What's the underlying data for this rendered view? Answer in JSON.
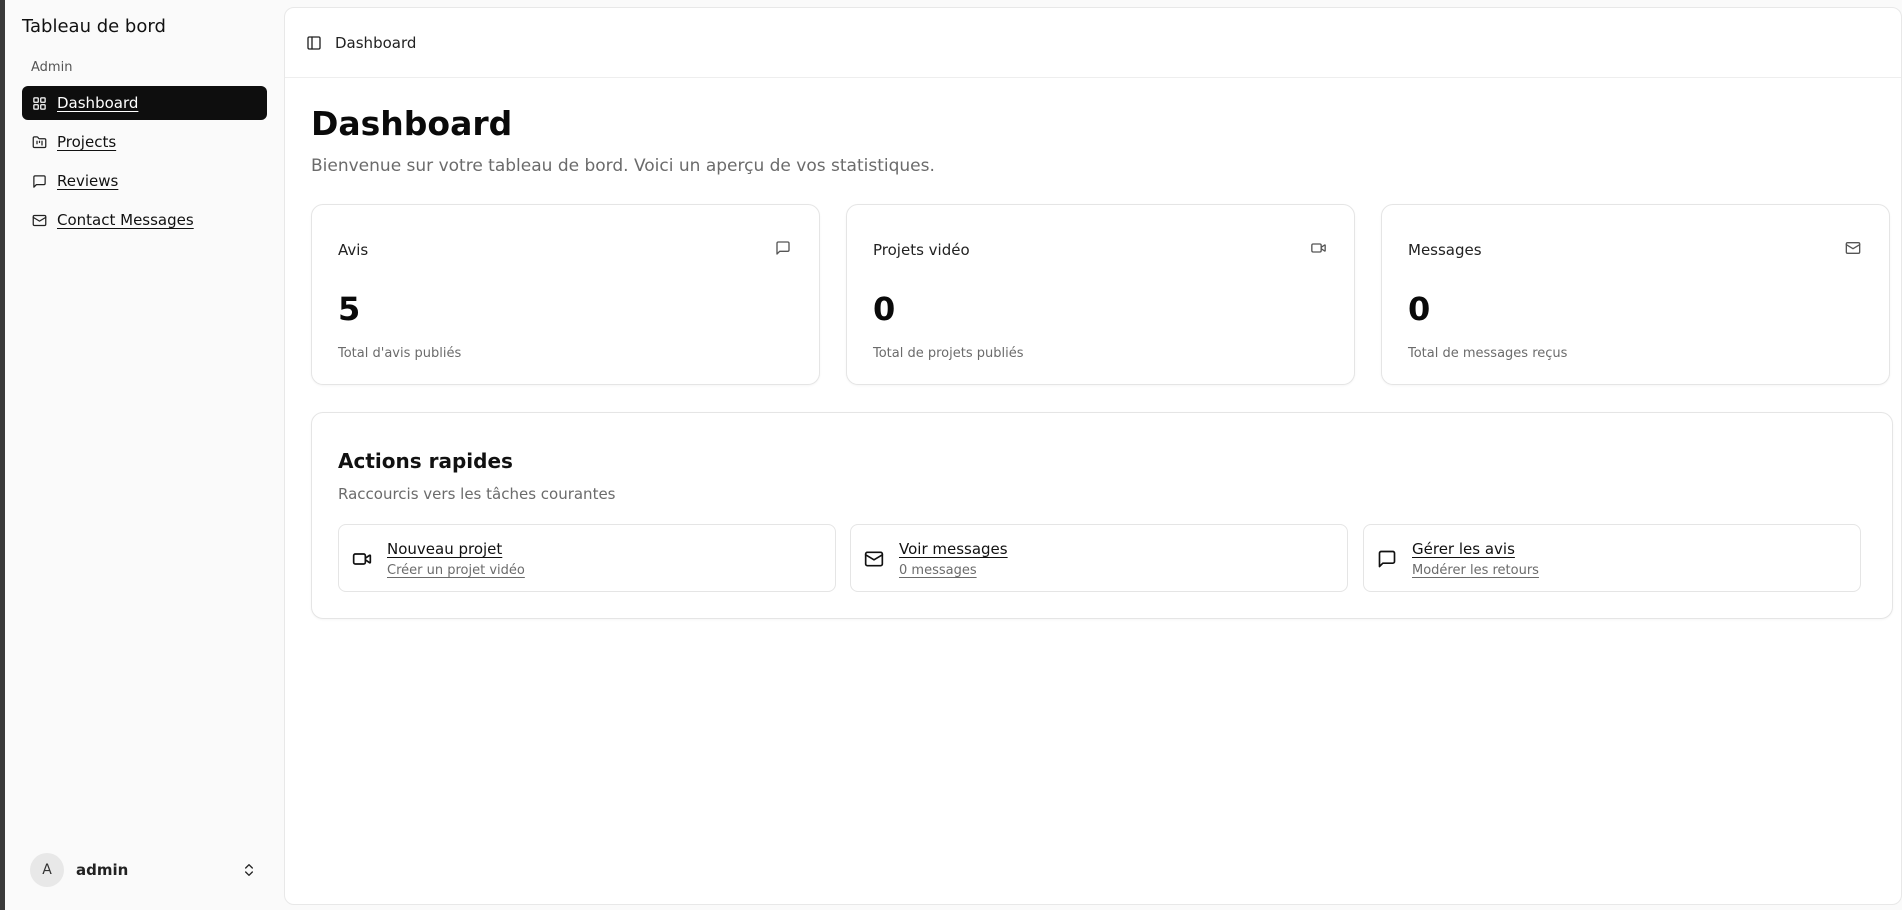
{
  "sidebar": {
    "brand": "Tableau de bord",
    "group_label": "Admin",
    "items": [
      {
        "label": "Dashboard",
        "icon": "grid-icon",
        "active": true
      },
      {
        "label": "Projects",
        "icon": "folder-icon",
        "active": false
      },
      {
        "label": "Reviews",
        "icon": "message-square-icon",
        "active": false
      },
      {
        "label": "Contact Messages",
        "icon": "mail-icon",
        "active": false
      }
    ],
    "user": {
      "avatar_letter": "A",
      "name": "admin"
    }
  },
  "topbar": {
    "breadcrumb": "Dashboard"
  },
  "page": {
    "title": "Dashboard",
    "subtitle": "Bienvenue sur votre tableau de bord. Voici un aperçu de vos statistiques."
  },
  "stats": [
    {
      "title": "Avis",
      "value": "5",
      "caption": "Total d'avis publiés",
      "icon": "message-square-icon"
    },
    {
      "title": "Projets vidéo",
      "value": "0",
      "caption": "Total de projets publiés",
      "icon": "video-icon"
    },
    {
      "title": "Messages",
      "value": "0",
      "caption": "Total de messages reçus",
      "icon": "mail-icon"
    }
  ],
  "actions": {
    "title": "Actions rapides",
    "subtitle": "Raccourcis vers les tâches courantes",
    "items": [
      {
        "label": "Nouveau projet",
        "desc": "Créer un projet vidéo",
        "icon": "video-icon"
      },
      {
        "label": "Voir messages",
        "desc": "0 messages",
        "icon": "mail-icon"
      },
      {
        "label": "Gérer les avis",
        "desc": "Modérer les retours",
        "icon": "message-square-icon"
      }
    ]
  },
  "colors": {
    "active_bg": "#0e0e0e",
    "muted_text": "#6b6b6b",
    "border": "#e5e5e5"
  }
}
